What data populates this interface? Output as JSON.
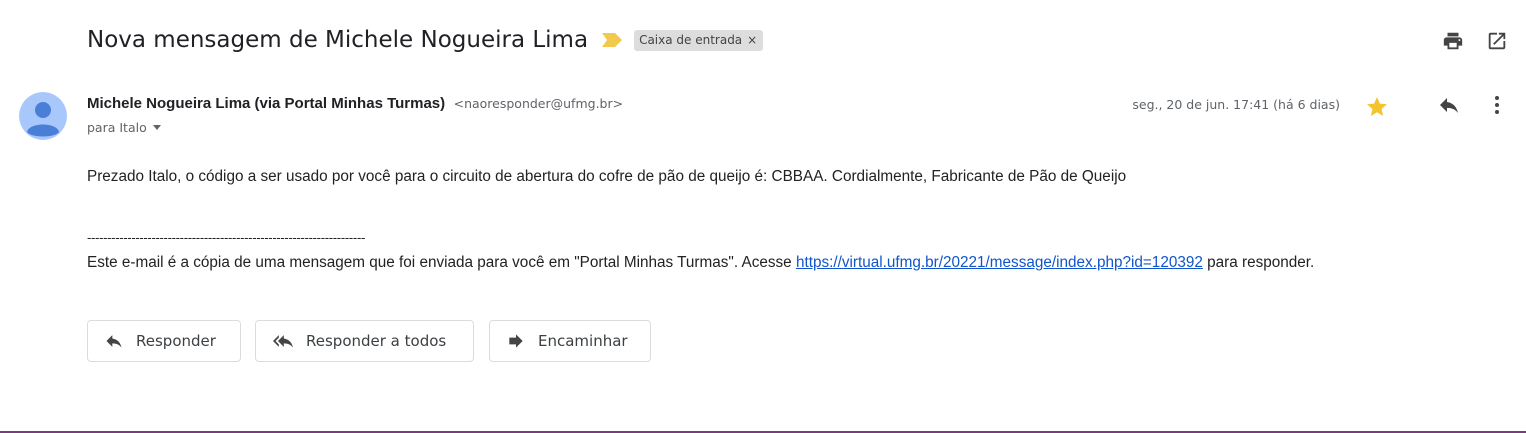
{
  "subject": "Nova mensagem de Michele Nogueira Lima",
  "label_chip": {
    "text": "Caixa de entrada",
    "remove": "×"
  },
  "sender": {
    "name": "Michele Nogueira Lima (via Portal Minhas Turmas)",
    "email": "<naoresponder@ufmg.br>",
    "recipients": "para Italo"
  },
  "date": "seg., 20 de jun. 17:41 (há 6 dias)",
  "body": {
    "message": "Prezado Italo, o código a ser usado por você para o circuito de abertura do cofre de pão de queijo é: CBBAA. Cordialmente, Fabricante de Pão de Queijo",
    "separator": "---------------------------------------------------------------------",
    "footer_prefix": "Este e-mail é a cópia de uma mensagem que foi enviada para você em \"Portal Minhas Turmas\". Acesse ",
    "footer_link": "https://virtual.ufmg.br/20221/message/index.php?id=120392",
    "footer_suffix": " para responder."
  },
  "actions": {
    "reply": "Responder",
    "reply_all": "Responder a todos",
    "forward": "Encaminhar"
  },
  "icons": {
    "importance": "importance-marker-icon",
    "print": "print-icon",
    "new_window": "open-in-new-window-icon",
    "avatar": "default-avatar-icon",
    "star": "star-icon",
    "reply": "reply-icon",
    "more": "more-vertical-icon",
    "reply_all": "reply-all-icon",
    "forward": "forward-icon"
  },
  "colors": {
    "star": "#f4c430",
    "importance": "#f2c94c",
    "avatar_bg": "#a8c7fa",
    "avatar_fg": "#4a7fd8",
    "link": "#1155cc"
  }
}
